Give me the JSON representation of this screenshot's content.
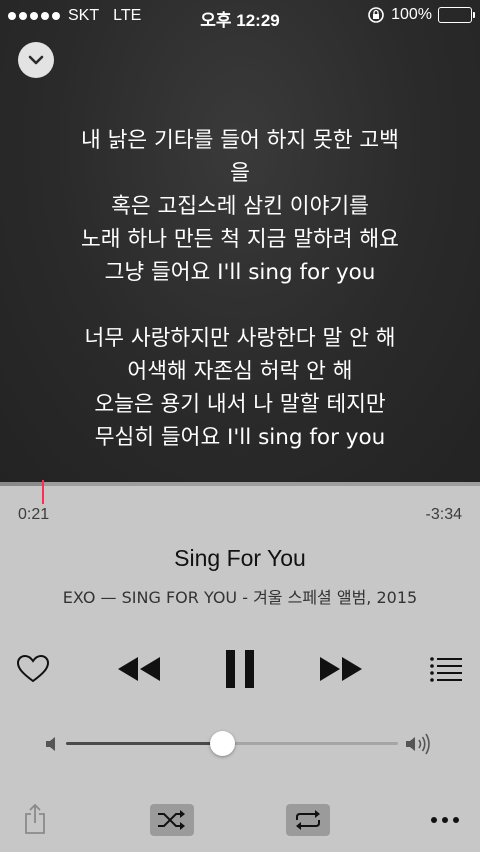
{
  "status_bar": {
    "carrier": "SKT",
    "network": "LTE",
    "time": "오후 12:29",
    "battery": "100%"
  },
  "lyrics": {
    "verse1": [
      "내 낡은 기타를 들어 하지 못한 고백",
      "을",
      "혹은 고집스레 삼킨 이야기를",
      "노래 하나 만든 척 지금 말하려 해요",
      "그냥 들어요 I'll sing for you"
    ],
    "verse2": [
      "너무 사랑하지만 사랑한다 말 안 해",
      "어색해 자존심 허락 안 해",
      "오늘은 용기 내서 나 말할 테지만",
      "무심히 들어요 I'll sing for you"
    ]
  },
  "playback": {
    "elapsed": "0:21",
    "remaining": "-3:34",
    "progress_fraction": 0.089,
    "volume_fraction": 0.47
  },
  "track": {
    "title": "Sing For You",
    "subtitle": "EXO — SING FOR YOU - 겨울 스페셜 앨범, 2015"
  },
  "icons": {
    "collapse": "chevron-down-icon",
    "like": "heart-icon",
    "previous": "rewind-icon",
    "play_pause": "pause-icon",
    "next": "fast-forward-icon",
    "queue": "list-icon",
    "volume_low": "speaker-low-icon",
    "volume_high": "speaker-high-icon",
    "share": "share-icon",
    "shuffle": "shuffle-icon",
    "repeat": "repeat-icon",
    "more": "more-icon"
  },
  "colors": {
    "accent": "#ff2d55",
    "lyrics_bg": "#2a2a2a",
    "controls_bg": "#c7c7c7"
  }
}
